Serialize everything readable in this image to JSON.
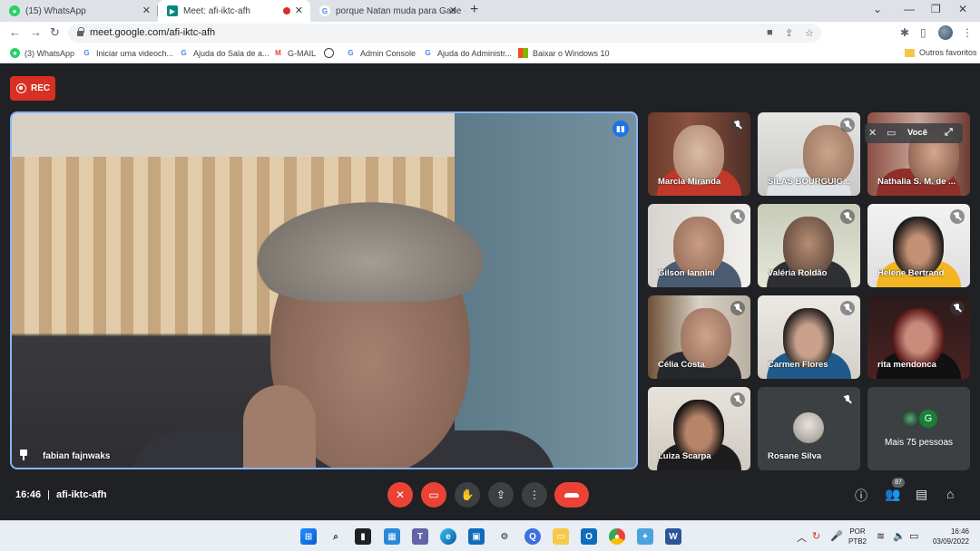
{
  "browser": {
    "tabs": [
      {
        "title": "(15) WhatsApp"
      },
      {
        "title": "Meet: afi-iktc-afh"
      },
      {
        "title": "porque Natan muda para Gade -"
      }
    ],
    "url": "meet.google.com/afi-iktc-afh",
    "bookmarks": [
      {
        "label": "(3) WhatsApp"
      },
      {
        "label": "Iniciar uma videoch..."
      },
      {
        "label": "Ajuda do Sala de a..."
      },
      {
        "label": "G-MAIL"
      },
      {
        "label": ""
      },
      {
        "label": "Admin Console"
      },
      {
        "label": "Ajuda do Administr..."
      },
      {
        "label": "Baixar o Windows 10"
      }
    ],
    "other_bookmarks": "Outros favoritos"
  },
  "meet": {
    "rec_label": "REC",
    "main_speaker": "fabian fajnwaks",
    "participants": [
      {
        "name": "Marcia Miranda"
      },
      {
        "name": "SILAS BOURGUIG..."
      },
      {
        "name": "Nathalia S. M. de ..."
      },
      {
        "name": "Gilson Iannini"
      },
      {
        "name": "Valéria Roldão"
      },
      {
        "name": "Helene Bertrand"
      },
      {
        "name": "Célia Costa"
      },
      {
        "name": "Carmen Flores"
      },
      {
        "name": "rita mendonca"
      },
      {
        "name": "Luiza Scarpa"
      },
      {
        "name": "Rosane Silva"
      }
    ],
    "you_label": "Você",
    "more_people": "Mais 75 pessoas",
    "more_avatar_letter": "G",
    "time": "16:46",
    "meeting_code": "afi-iktc-afh",
    "people_count": "87"
  },
  "taskbar": {
    "lang_line1": "POR",
    "lang_line2": "PTB2",
    "time": "16:46",
    "date": "03/09/2022"
  }
}
